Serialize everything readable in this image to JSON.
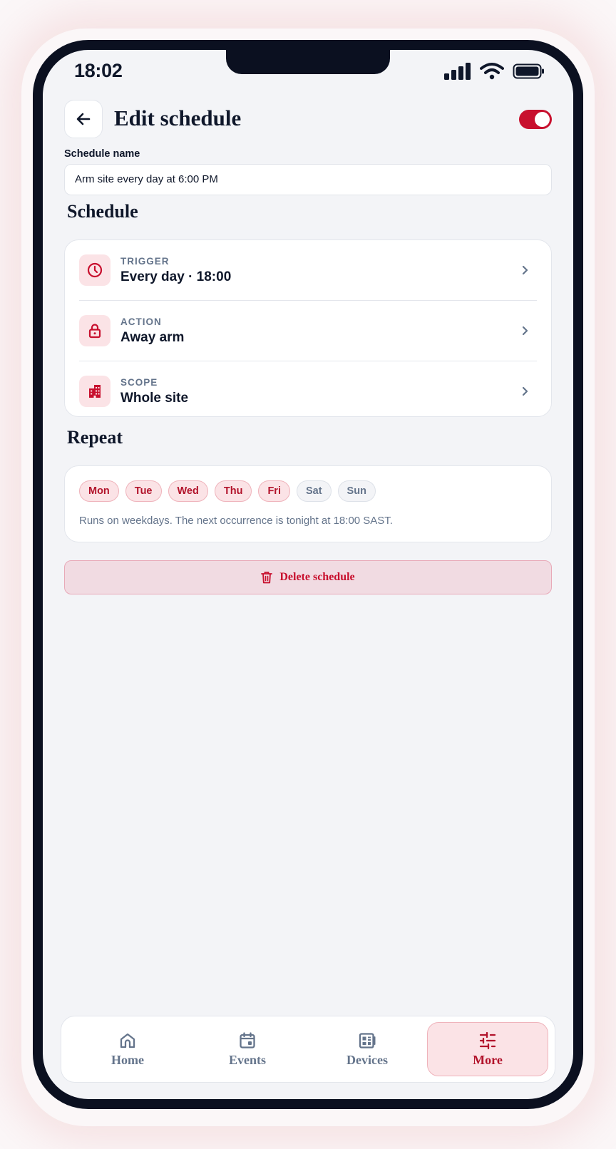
{
  "status_bar": {
    "time": "18:02"
  },
  "header": {
    "title": "Edit schedule",
    "enabled": true
  },
  "schedule_name": {
    "label": "Schedule name",
    "value": "Arm site every day at 6:00 PM"
  },
  "schedule_section": {
    "title": "Schedule",
    "rows": [
      {
        "kicker": "TRIGGER",
        "value": "Every day · 18:00",
        "icon": "clock-icon"
      },
      {
        "kicker": "ACTION",
        "value": "Away arm",
        "icon": "lock-icon"
      },
      {
        "kicker": "SCOPE",
        "value": "Whole site",
        "icon": "building-icon"
      }
    ]
  },
  "repeat_section": {
    "title": "Repeat",
    "days": [
      {
        "label": "Mon",
        "selected": true
      },
      {
        "label": "Tue",
        "selected": true
      },
      {
        "label": "Wed",
        "selected": true
      },
      {
        "label": "Thu",
        "selected": true
      },
      {
        "label": "Fri",
        "selected": true
      },
      {
        "label": "Sat",
        "selected": false
      },
      {
        "label": "Sun",
        "selected": false
      }
    ],
    "note": "Runs on weekdays. The next occurrence is tonight at 18:00 SAST."
  },
  "delete_button": {
    "label": "Delete schedule"
  },
  "tab_bar": {
    "tabs": [
      {
        "label": "Home",
        "icon": "home-icon",
        "active": false
      },
      {
        "label": "Events",
        "icon": "calendar-icon",
        "active": false
      },
      {
        "label": "Devices",
        "icon": "devices-icon",
        "active": false
      },
      {
        "label": "More",
        "icon": "sliders-icon",
        "active": true
      }
    ]
  },
  "colors": {
    "accent": "#c8102e",
    "accent_soft": "#fbe3e6",
    "text": "#0f172a",
    "muted": "#64748b",
    "background": "#f3f4f7"
  }
}
